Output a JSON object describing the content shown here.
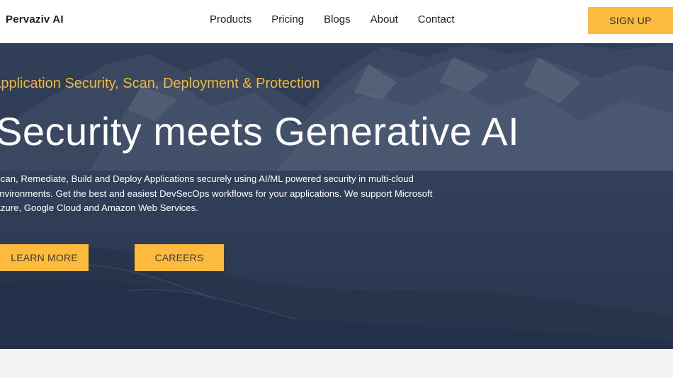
{
  "header": {
    "logo": "Pervaziv AI",
    "nav": [
      "Products",
      "Pricing",
      "Blogs",
      "About",
      "Contact"
    ],
    "signup_label": "SIGN UP"
  },
  "hero": {
    "kicker": "Application Security, Scan, Deployment & Protection",
    "title": "Security meets Generative AI",
    "description_lines": [
      "Scan, Remediate, Build and Deploy Applications securely using AI/ML powered security in multi-cloud",
      "environments. Get the best and easiest DevSecOps workflows for your applications. We support Microsoft",
      "Azure, Google Cloud and Amazon Web Services."
    ],
    "learn_more_label": "LEARN MORE",
    "careers_label": "CAREERS"
  },
  "colors": {
    "accent": "#fdbb3e",
    "kicker": "#f5b63c",
    "hero_bg": "#2e3a52",
    "header_bg": "#ffffff"
  }
}
